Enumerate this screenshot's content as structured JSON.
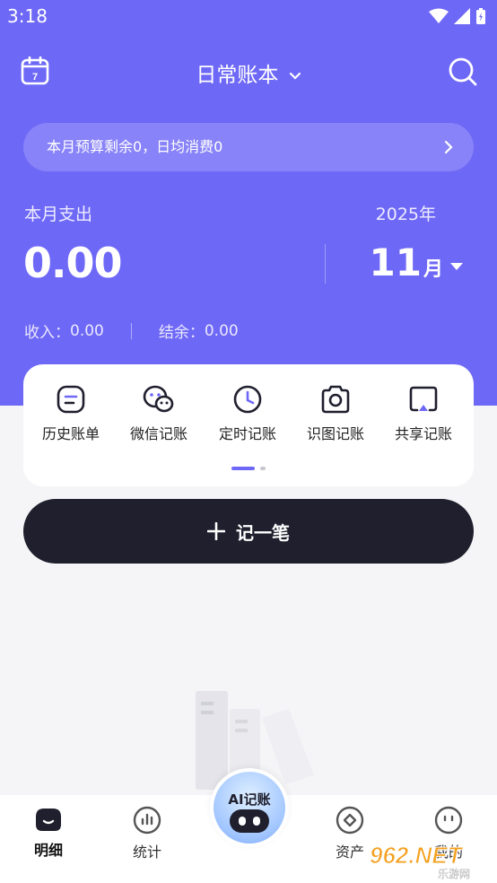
{
  "status_bar": {
    "time": "3:18"
  },
  "header": {
    "book_name": "日常账本"
  },
  "budget": {
    "text": "本月预算剩余0，日均消费0"
  },
  "summary": {
    "spend_label": "本月支出",
    "spend_amount": "0.00",
    "year": "2025年",
    "month": "11",
    "month_unit": "月",
    "income_label": "收入：",
    "income_value": "0.00",
    "balance_label": "结余：",
    "balance_value": "0.00"
  },
  "quick_actions": [
    {
      "label": "历史账单",
      "icon": "bill-history-icon"
    },
    {
      "label": "微信记账",
      "icon": "wechat-icon"
    },
    {
      "label": "定时记账",
      "icon": "clock-icon"
    },
    {
      "label": "识图记账",
      "icon": "camera-icon"
    },
    {
      "label": "共享记账",
      "icon": "share-screen-icon"
    }
  ],
  "record_button": {
    "label": "记一笔"
  },
  "tabs": [
    {
      "label": "明细",
      "icon": "detail-home-icon",
      "active": true
    },
    {
      "label": "统计",
      "icon": "stats-icon"
    },
    {
      "label": "资产",
      "icon": "assets-icon"
    },
    {
      "label": "我的",
      "icon": "profile-icon"
    }
  ],
  "ai_button": {
    "label": "AI记账"
  },
  "watermark": {
    "text": "962.NET",
    "sub": "乐游网"
  },
  "colors": {
    "primary": "#6e68f7",
    "dark": "#1f1f2e",
    "background": "#f5f5f7"
  }
}
